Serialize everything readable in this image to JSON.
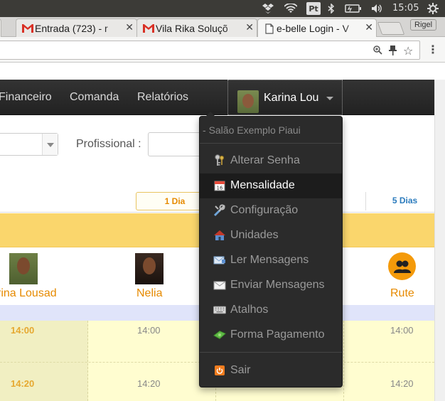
{
  "os": {
    "language_badge": "Pt",
    "time": "15:05",
    "icons": [
      "dropbox-icon",
      "wifi-icon",
      "keyboard-language-icon",
      "bluetooth-icon",
      "battery-icon",
      "volume-icon",
      "settings-gear-icon"
    ]
  },
  "browser": {
    "tabs": [
      {
        "title": "Entrada (723) - r",
        "icon": "gmail-icon",
        "icon_color": "#d93025"
      },
      {
        "title": "Vila Rika Soluçõ",
        "icon": "gmail-icon",
        "icon_color": "#d93025"
      },
      {
        "title": "e-belle Login - V",
        "icon": "document-icon",
        "icon_color": "#555555"
      }
    ],
    "profile_name": "Rigel",
    "address_icons": [
      "zoom-icon",
      "pin-extension-icon",
      "bookmark-star-icon"
    ]
  },
  "navbar": {
    "items": [
      "Financeiro",
      "Comanda",
      "Relatórios"
    ],
    "user_name": "Karina Lou"
  },
  "filters": {
    "profissional_label": "Profissional :",
    "profissional_value": ""
  },
  "days": {
    "current": "1 Dia",
    "other": "5 Dias"
  },
  "staff": [
    {
      "name": "rina Lousad"
    },
    {
      "name": "Nelia"
    },
    {
      "name": "Rute"
    }
  ],
  "grid": {
    "row1_time": "14:00",
    "row2_time": "14:20"
  },
  "dropdown": {
    "header": "Salão Exemplo Piaui",
    "items": [
      {
        "label": "Alterar Senha",
        "icon": "keys-icon"
      },
      {
        "label": "Mensalidade",
        "icon": "calendar-icon"
      },
      {
        "label": "Configuração",
        "icon": "tools-icon"
      },
      {
        "label": "Unidades",
        "icon": "house-icon"
      },
      {
        "label": "Ler Mensagens",
        "icon": "message-read-icon"
      },
      {
        "label": "Enviar Mensagens",
        "icon": "envelope-icon"
      },
      {
        "label": "Atalhos",
        "icon": "keyboard-icon"
      },
      {
        "label": "Forma Pagamento",
        "icon": "money-icon"
      }
    ],
    "logout": {
      "label": "Sair",
      "icon": "logout-icon"
    },
    "active_item": "Mensalidade"
  },
  "colors": {
    "accent_orange": "#e68a00",
    "link_blue": "#2b7bbd",
    "band_yellow": "#fad66c",
    "navbar_dark": "#222222"
  }
}
